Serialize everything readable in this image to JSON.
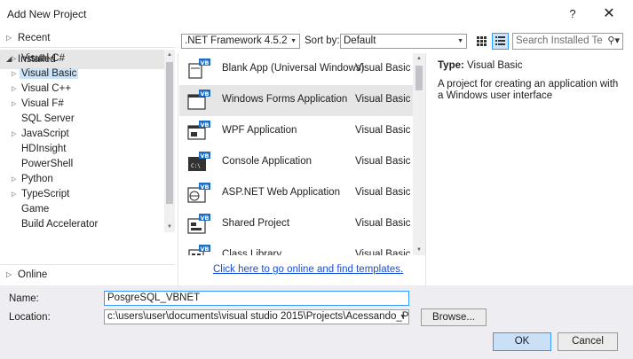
{
  "window": {
    "title": "Add New Project",
    "help_label": "?",
    "close_label": "✕"
  },
  "tree": {
    "recent": "Recent",
    "installed": "Installed",
    "online": "Online",
    "items": [
      {
        "label": "Visual C#",
        "expandable": true
      },
      {
        "label": "Visual Basic",
        "expandable": true,
        "selected": true
      },
      {
        "label": "Visual C++",
        "expandable": true
      },
      {
        "label": "Visual F#",
        "expandable": true
      },
      {
        "label": "SQL Server",
        "expandable": false
      },
      {
        "label": "JavaScript",
        "expandable": true
      },
      {
        "label": "HDInsight",
        "expandable": false
      },
      {
        "label": "PowerShell",
        "expandable": false
      },
      {
        "label": "Python",
        "expandable": true
      },
      {
        "label": "TypeScript",
        "expandable": true
      },
      {
        "label": "Game",
        "expandable": false
      },
      {
        "label": "Build Accelerator",
        "expandable": false
      }
    ]
  },
  "toolbar": {
    "framework": ".NET Framework 4.5.2",
    "sort_label": "Sort by:",
    "sort_value": "Default",
    "search_placeholder": "Search Installed Te"
  },
  "templates": [
    {
      "name": "Blank App (Universal Windows)",
      "lang": "Visual Basic",
      "icon": "uwp-app-icon"
    },
    {
      "name": "Windows Forms Application",
      "lang": "Visual Basic",
      "icon": "winforms-icon",
      "selected": true
    },
    {
      "name": "WPF Application",
      "lang": "Visual Basic",
      "icon": "wpf-icon"
    },
    {
      "name": "Console Application",
      "lang": "Visual Basic",
      "icon": "console-icon"
    },
    {
      "name": "ASP.NET Web Application",
      "lang": "Visual Basic",
      "icon": "aspnet-icon"
    },
    {
      "name": "Shared Project",
      "lang": "Visual Basic",
      "icon": "shared-project-icon"
    },
    {
      "name": "Class Library",
      "lang": "Visual Basic",
      "icon": "class-library-icon"
    }
  ],
  "online_link": "Click here to go online and find templates.",
  "details": {
    "type_label": "Type:",
    "type_value": "Visual Basic",
    "description": "A project for creating an application with a Windows user interface"
  },
  "form": {
    "name_label": "Name:",
    "name_value": "PosgreSQL_VBNET",
    "location_label": "Location:",
    "location_value": "c:\\users\\user\\documents\\visual studio 2015\\Projects\\Acessando_Pos",
    "browse_label": "Browse...",
    "ok_label": "OK",
    "cancel_label": "Cancel"
  },
  "colors": {
    "vb_badge": "#1d6dc4",
    "selection": "#cce4f7",
    "link": "#1a4ed8"
  }
}
